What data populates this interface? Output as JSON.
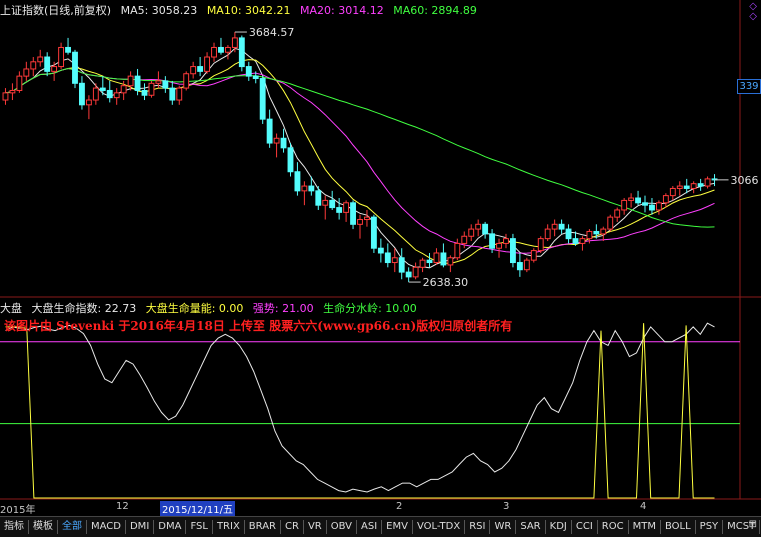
{
  "main_header": {
    "name": "上证指数(日线,前复权)",
    "ma5": "MA5: 3058.23",
    "ma10": "MA10: 3042.21",
    "ma20": "MA20: 3014.12",
    "ma60": "MA60: 2894.89",
    "colors": {
      "name": "#e8e8e8",
      "ma5": "#e8e8e8",
      "ma10": "#ffff40",
      "ma20": "#ff40ff",
      "ma60": "#40ff40"
    }
  },
  "price_tag": "339",
  "indicator_header": {
    "name": "大盘",
    "life_index": "大盘生命指数: 22.73",
    "life_volume": "大盘生命量能: 0.00",
    "strong": "强势: 21.00",
    "watershed": "生命分水岭: 10.00",
    "colors": {
      "life_index": "#e8e8e8",
      "life_volume": "#ffff40",
      "strong": "#ff40ff",
      "watershed": "#40ff40"
    }
  },
  "watermark": "该图片由 Stevenki 于2016年4月18日 上传至 股票六六(www.gp66.cn)版权归原创者所有",
  "time_axis": {
    "left": "2015年",
    "m12": "12",
    "date": "2015/12/11/五",
    "m2": "2",
    "m3": "3",
    "m4": "4"
  },
  "tabs": [
    "指标",
    "模板",
    "全部",
    "MACD",
    "DMI",
    "DMA",
    "FSL",
    "TRIX",
    "BRAR",
    "CR",
    "VR",
    "OBV",
    "ASI",
    "EMV",
    "VOL-TDX",
    "RSI",
    "WR",
    "SAR",
    "KDJ",
    "CCI",
    "ROC",
    "MTM",
    "BOLL",
    "PSY",
    "MCST"
  ],
  "active_tab": "全部",
  "chart_data": [
    {
      "type": "candlestick",
      "title": "上证指数(日线,前复权)",
      "annotations": [
        {
          "text": "3684.57",
          "value": 3684.57,
          "label": "high"
        },
        {
          "text": "2638.30",
          "value": 2638.3,
          "label": "low"
        },
        {
          "text": "3066",
          "value": 3066,
          "label": "last"
        }
      ],
      "ylim": [
        2580,
        3760
      ],
      "series": [
        {
          "name": "MA5",
          "color": "#e8e8e8",
          "last": 3058.23
        },
        {
          "name": "MA10",
          "color": "#ffff40",
          "last": 3042.21
        },
        {
          "name": "MA20",
          "color": "#ff40ff",
          "last": 3014.12
        },
        {
          "name": "MA60",
          "color": "#40ff40",
          "last": 2894.89
        }
      ],
      "candles": [
        [
          3400,
          3450,
          3380,
          3430
        ],
        [
          3430,
          3470,
          3400,
          3440
        ],
        [
          3440,
          3520,
          3430,
          3500
        ],
        [
          3500,
          3560,
          3480,
          3530
        ],
        [
          3530,
          3580,
          3500,
          3560
        ],
        [
          3560,
          3610,
          3540,
          3580
        ],
        [
          3580,
          3600,
          3500,
          3520
        ],
        [
          3520,
          3560,
          3480,
          3540
        ],
        [
          3540,
          3640,
          3530,
          3620
        ],
        [
          3620,
          3660,
          3590,
          3600
        ],
        [
          3600,
          3610,
          3450,
          3470
        ],
        [
          3470,
          3500,
          3360,
          3380
        ],
        [
          3380,
          3420,
          3320,
          3400
        ],
        [
          3400,
          3470,
          3380,
          3450
        ],
        [
          3450,
          3500,
          3420,
          3440
        ],
        [
          3440,
          3480,
          3390,
          3410
        ],
        [
          3410,
          3450,
          3380,
          3430
        ],
        [
          3430,
          3480,
          3400,
          3460
        ],
        [
          3460,
          3520,
          3440,
          3500
        ],
        [
          3500,
          3530,
          3420,
          3440
        ],
        [
          3440,
          3470,
          3400,
          3420
        ],
        [
          3420,
          3480,
          3410,
          3470
        ],
        [
          3470,
          3520,
          3450,
          3480
        ],
        [
          3480,
          3500,
          3430,
          3450
        ],
        [
          3450,
          3480,
          3380,
          3400
        ],
        [
          3400,
          3460,
          3380,
          3450
        ],
        [
          3450,
          3520,
          3440,
          3510
        ],
        [
          3510,
          3560,
          3490,
          3540
        ],
        [
          3540,
          3580,
          3500,
          3520
        ],
        [
          3520,
          3600,
          3510,
          3580
        ],
        [
          3580,
          3640,
          3560,
          3620
        ],
        [
          3620,
          3660,
          3590,
          3600
        ],
        [
          3600,
          3630,
          3570,
          3620
        ],
        [
          3620,
          3684.57,
          3600,
          3660
        ],
        [
          3660,
          3670,
          3520,
          3540
        ],
        [
          3540,
          3560,
          3480,
          3500
        ],
        [
          3500,
          3520,
          3470,
          3490
        ],
        [
          3490,
          3500,
          3300,
          3320
        ],
        [
          3320,
          3360,
          3200,
          3220
        ],
        [
          3220,
          3260,
          3160,
          3240
        ],
        [
          3240,
          3280,
          3180,
          3200
        ],
        [
          3200,
          3220,
          3080,
          3100
        ],
        [
          3100,
          3140,
          3000,
          3020
        ],
        [
          3020,
          3060,
          2960,
          3040
        ],
        [
          3040,
          3080,
          3000,
          3020
        ],
        [
          3020,
          3040,
          2940,
          2960
        ],
        [
          2960,
          3000,
          2900,
          2980
        ],
        [
          2980,
          3020,
          2940,
          2950
        ],
        [
          2950,
          2990,
          2900,
          2930
        ],
        [
          2930,
          2980,
          2890,
          2970
        ],
        [
          2970,
          2980,
          2860,
          2880
        ],
        [
          2880,
          2920,
          2820,
          2900
        ],
        [
          2900,
          2940,
          2870,
          2910
        ],
        [
          2910,
          2920,
          2760,
          2780
        ],
        [
          2780,
          2820,
          2720,
          2760
        ],
        [
          2760,
          2800,
          2700,
          2720
        ],
        [
          2720,
          2780,
          2680,
          2740
        ],
        [
          2740,
          2780,
          2650,
          2680
        ],
        [
          2680,
          2700,
          2638.3,
          2660
        ],
        [
          2660,
          2720,
          2650,
          2700
        ],
        [
          2700,
          2740,
          2680,
          2730
        ],
        [
          2730,
          2760,
          2700,
          2720
        ],
        [
          2720,
          2780,
          2710,
          2760
        ],
        [
          2760,
          2800,
          2700,
          2710
        ],
        [
          2710,
          2750,
          2680,
          2740
        ],
        [
          2740,
          2820,
          2730,
          2800
        ],
        [
          2800,
          2850,
          2780,
          2830
        ],
        [
          2830,
          2880,
          2810,
          2860
        ],
        [
          2860,
          2900,
          2830,
          2880
        ],
        [
          2880,
          2890,
          2820,
          2840
        ],
        [
          2840,
          2860,
          2760,
          2780
        ],
        [
          2780,
          2820,
          2740,
          2800
        ],
        [
          2800,
          2840,
          2780,
          2820
        ],
        [
          2820,
          2840,
          2700,
          2720
        ],
        [
          2720,
          2760,
          2660,
          2690
        ],
        [
          2690,
          2740,
          2680,
          2730
        ],
        [
          2730,
          2780,
          2720,
          2770
        ],
        [
          2770,
          2830,
          2760,
          2820
        ],
        [
          2820,
          2880,
          2810,
          2860
        ],
        [
          2860,
          2900,
          2830,
          2880
        ],
        [
          2880,
          2900,
          2840,
          2860
        ],
        [
          2860,
          2880,
          2800,
          2820
        ],
        [
          2820,
          2850,
          2790,
          2800
        ],
        [
          2800,
          2830,
          2770,
          2820
        ],
        [
          2820,
          2860,
          2800,
          2850
        ],
        [
          2850,
          2880,
          2820,
          2840
        ],
        [
          2840,
          2870,
          2810,
          2860
        ],
        [
          2860,
          2920,
          2850,
          2910
        ],
        [
          2910,
          2950,
          2890,
          2940
        ],
        [
          2940,
          2990,
          2920,
          2980
        ],
        [
          2980,
          3010,
          2950,
          2990
        ],
        [
          2990,
          3020,
          2960,
          2970
        ],
        [
          2970,
          3000,
          2930,
          2960
        ],
        [
          2960,
          2990,
          2920,
          2940
        ],
        [
          2940,
          2980,
          2920,
          2970
        ],
        [
          2970,
          3010,
          2950,
          3000
        ],
        [
          3000,
          3040,
          2980,
          3030
        ],
        [
          3030,
          3060,
          3000,
          3040
        ],
        [
          3040,
          3070,
          3010,
          3030
        ],
        [
          3030,
          3060,
          3010,
          3050
        ],
        [
          3050,
          3070,
          3020,
          3040
        ],
        [
          3040,
          3080,
          3030,
          3070
        ],
        [
          3070,
          3090,
          3040,
          3066
        ]
      ]
    },
    {
      "type": "line",
      "title": "大盘",
      "ylim": [
        0,
        25
      ],
      "reference_lines": [
        {
          "name": "强势",
          "value": 21.0,
          "color": "#ff40ff"
        },
        {
          "name": "生命分水岭",
          "value": 10.0,
          "color": "#40ff40"
        }
      ],
      "series": [
        {
          "name": "大盘生命指数",
          "color": "#e8e8e8",
          "values": [
            22.5,
            23,
            22.8,
            22.6,
            22.9,
            23.1,
            22.7,
            22.5,
            22.9,
            23.2,
            22.8,
            22.1,
            20.5,
            18.0,
            16.0,
            15.5,
            17.0,
            18.5,
            18.0,
            16.5,
            14.8,
            13.0,
            11.5,
            10.5,
            11.0,
            12.5,
            14.5,
            16.5,
            18.5,
            20.5,
            21.5,
            22.0,
            21.5,
            20.5,
            19.0,
            17.0,
            14.5,
            12.0,
            9.0,
            7.0,
            6.0,
            5.0,
            4.5,
            3.5,
            2.5,
            2.0,
            1.5,
            1.0,
            0.8,
            1.2,
            1.0,
            0.8,
            1.2,
            1.5,
            1.0,
            1.5,
            2.0,
            2.0,
            1.5,
            2.0,
            2.5,
            2.5,
            3.0,
            3.5,
            4.5,
            5.5,
            6.0,
            5.0,
            4.5,
            3.5,
            4.0,
            5.0,
            6.5,
            8.5,
            10.5,
            12.5,
            13.5,
            12.0,
            11.5,
            13.5,
            15.5,
            18.5,
            21.0,
            22.5,
            21.0,
            20.5,
            22.5,
            21.0,
            19.0,
            19.5,
            21.5,
            23.0,
            22.0,
            21.0,
            21.0,
            21.5,
            22.0,
            23.0,
            22.0,
            23.5,
            23.0
          ]
        },
        {
          "name": "大盘生命量能",
          "color": "#ffff40",
          "values": [
            23,
            23,
            23,
            22.8,
            0,
            0,
            0,
            0,
            0,
            0,
            0,
            0,
            0,
            0,
            0,
            0,
            0,
            0,
            0,
            0,
            0,
            0,
            0,
            0,
            0,
            0,
            0,
            0,
            0,
            0,
            0,
            0,
            0,
            0,
            0,
            0,
            0,
            0,
            0,
            0,
            0,
            0,
            0,
            0,
            0,
            0,
            0,
            0,
            0,
            0,
            0,
            0,
            0,
            0,
            0,
            0,
            0,
            0,
            0,
            0,
            0,
            0,
            0,
            0,
            0,
            0,
            0,
            0,
            0,
            0,
            0,
            0,
            0,
            0,
            0,
            0,
            0,
            0,
            0,
            0,
            0,
            0,
            0,
            0,
            22.5,
            0,
            0,
            0,
            0,
            0,
            23.5,
            0,
            0,
            0,
            0,
            0,
            23.2,
            0,
            0,
            0,
            0
          ]
        }
      ]
    }
  ]
}
